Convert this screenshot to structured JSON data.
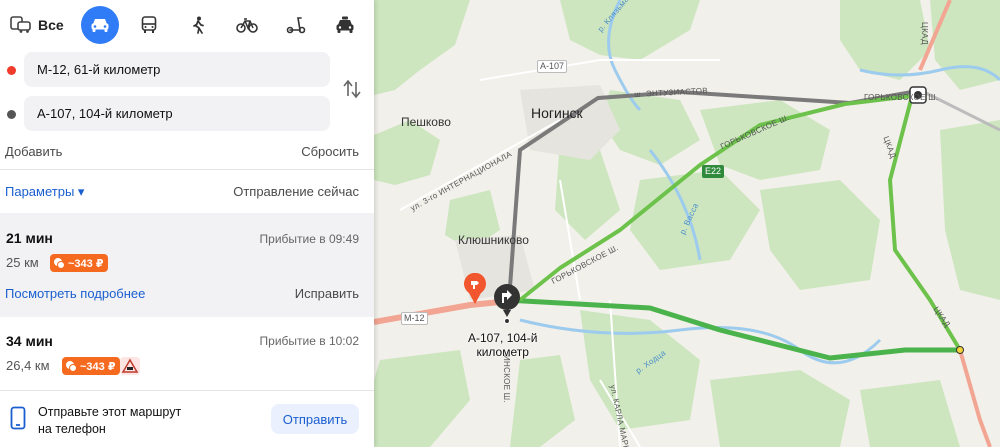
{
  "modes": {
    "all_label": "Все",
    "items": [
      "car-icon",
      "bus-icon",
      "walk-icon",
      "bike-icon",
      "scooter-icon",
      "taxi-icon"
    ],
    "active": "car-icon"
  },
  "route": {
    "from": "М-12, 61-й километр",
    "to": "А-107, 104-й километр",
    "add": "Добавить",
    "reset": "Сбросить",
    "params": "Параметры ▾",
    "departure": "Отправление сейчас"
  },
  "routes": [
    {
      "duration": "21 мин",
      "arrival": "Прибытие в 09:49",
      "distance": "25 км",
      "toll": "~343 ₽",
      "details": "Посмотреть подробнее",
      "fix": "Исправить"
    },
    {
      "duration": "34 мин",
      "arrival": "Прибытие в 10:02",
      "distance": "26,4 км",
      "toll": "~343 ₽"
    }
  ],
  "send": {
    "text_line1": "Отправьте этот маршрут",
    "text_line2": "на телефон",
    "button": "Отправить"
  },
  "map": {
    "town": "Ногинск",
    "villages": [
      "Пешково",
      "Клюшниково"
    ],
    "streets": {
      "entuz": "ш. ЭНТУЗИАСТОВ",
      "gork1": "ГОРЬКОВСКОЕ Ш.",
      "gork2": "ГОРЬКОВСКОЕ Ш.",
      "gork3": "ГОРЬКОВСКОЕ Ш.",
      "internac": "ул. 3-го ИНТЕРНАЦИОНАЛА",
      "klyazma": "р. Клязьма",
      "vassa": "р. Васса",
      "hodtsa": "р. Ходца",
      "kmarksa": "ул. КАРЛА МАРКСА",
      "tskad1": "ЦКАД",
      "tskad2": "ЦКАД",
      "tskad3": "ЦКАД",
      "inskoe": "ИНСКОЕ Ш."
    },
    "shields": {
      "a107": "А-107",
      "m12": "М-12",
      "e22": "Е22"
    },
    "destination": [
      "А-107, 104-й",
      "километр"
    ],
    "colors": {
      "route": "#4bb34b",
      "alt_route": "#7a7a7a",
      "forest": "#cce5bd",
      "water": "#9ccbee",
      "start": "#f1562f",
      "finish": "#333333"
    }
  }
}
